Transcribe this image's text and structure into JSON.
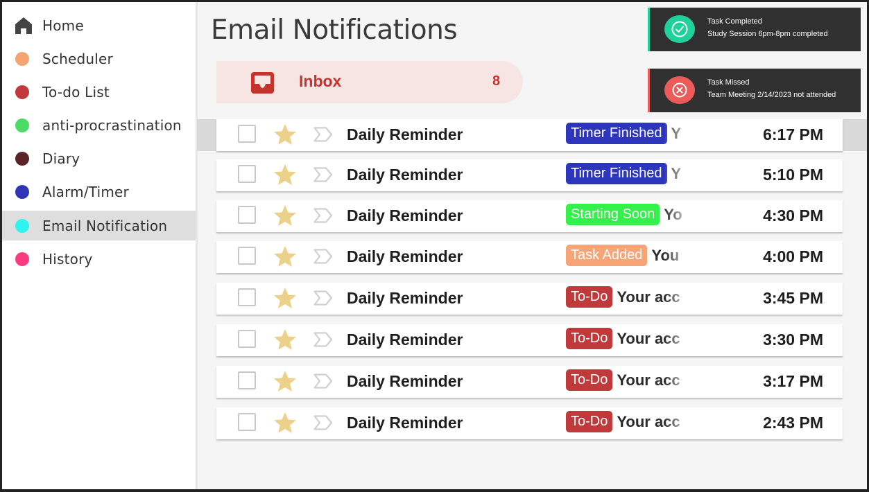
{
  "sidebar": {
    "items": [
      {
        "label": "Home",
        "icon": "home-icon",
        "color": "#444444"
      },
      {
        "label": "Scheduler",
        "icon": "dot",
        "color": "#f4a373"
      },
      {
        "label": "To-do List",
        "icon": "dot",
        "color": "#c0393b"
      },
      {
        "label": "anti-procrastination",
        "icon": "dot",
        "color": "#4cd964"
      },
      {
        "label": "Diary",
        "icon": "dot",
        "color": "#5a2426"
      },
      {
        "label": "Alarm/Timer",
        "icon": "dot",
        "color": "#2f35b5"
      },
      {
        "label": "Email Notification",
        "icon": "dot",
        "color": "#2ef3f0",
        "active": true
      },
      {
        "label": "History",
        "icon": "dot",
        "color": "#fb3b7e"
      }
    ]
  },
  "main": {
    "title": "Email Notifications",
    "inbox": {
      "label": "Inbox",
      "count": "8",
      "icon": "inbox-icon",
      "color": "#c5332c"
    }
  },
  "toasts": [
    {
      "title": "Task Completed",
      "message": "Study Session 6pm-8pm completed",
      "icon": "check-circle-icon",
      "color": "#1fd19a"
    },
    {
      "title": "Task Missed",
      "message": "Team Meeting 2/14/2023 not attended",
      "icon": "x-circle-icon",
      "color": "#ec5a5a"
    }
  ],
  "emails": [
    {
      "sender": "Daily Reminder",
      "tag": "Timer Finished",
      "tag_color": "#2d35bb",
      "snippet": "Y",
      "time": "6:17 PM",
      "highlighted": true
    },
    {
      "sender": "Daily Reminder",
      "tag": "Timer Finished",
      "tag_color": "#2d35bb",
      "snippet": "Y",
      "time": "5:10 PM"
    },
    {
      "sender": "Daily Reminder",
      "tag": "Starting Soon",
      "tag_color": "#34f04a",
      "snippet": "Yo",
      "time": "4:30 PM"
    },
    {
      "sender": "Daily Reminder",
      "tag": "Task Added",
      "tag_color": "#f7a477",
      "snippet": "You",
      "time": "4:00 PM"
    },
    {
      "sender": "Daily Reminder",
      "tag": "To-Do",
      "tag_color": "#c0393b",
      "snippet": "Your acc",
      "time": "3:45 PM"
    },
    {
      "sender": "Daily Reminder",
      "tag": "To-Do",
      "tag_color": "#c0393b",
      "snippet": "Your acc",
      "time": "3:30 PM"
    },
    {
      "sender": "Daily Reminder",
      "tag": "To-Do",
      "tag_color": "#c0393b",
      "snippet": "Your acc",
      "time": "3:17 PM"
    },
    {
      "sender": "Daily Reminder",
      "tag": "To-Do",
      "tag_color": "#c0393b",
      "snippet": "Your acc",
      "time": "2:43 PM"
    }
  ]
}
